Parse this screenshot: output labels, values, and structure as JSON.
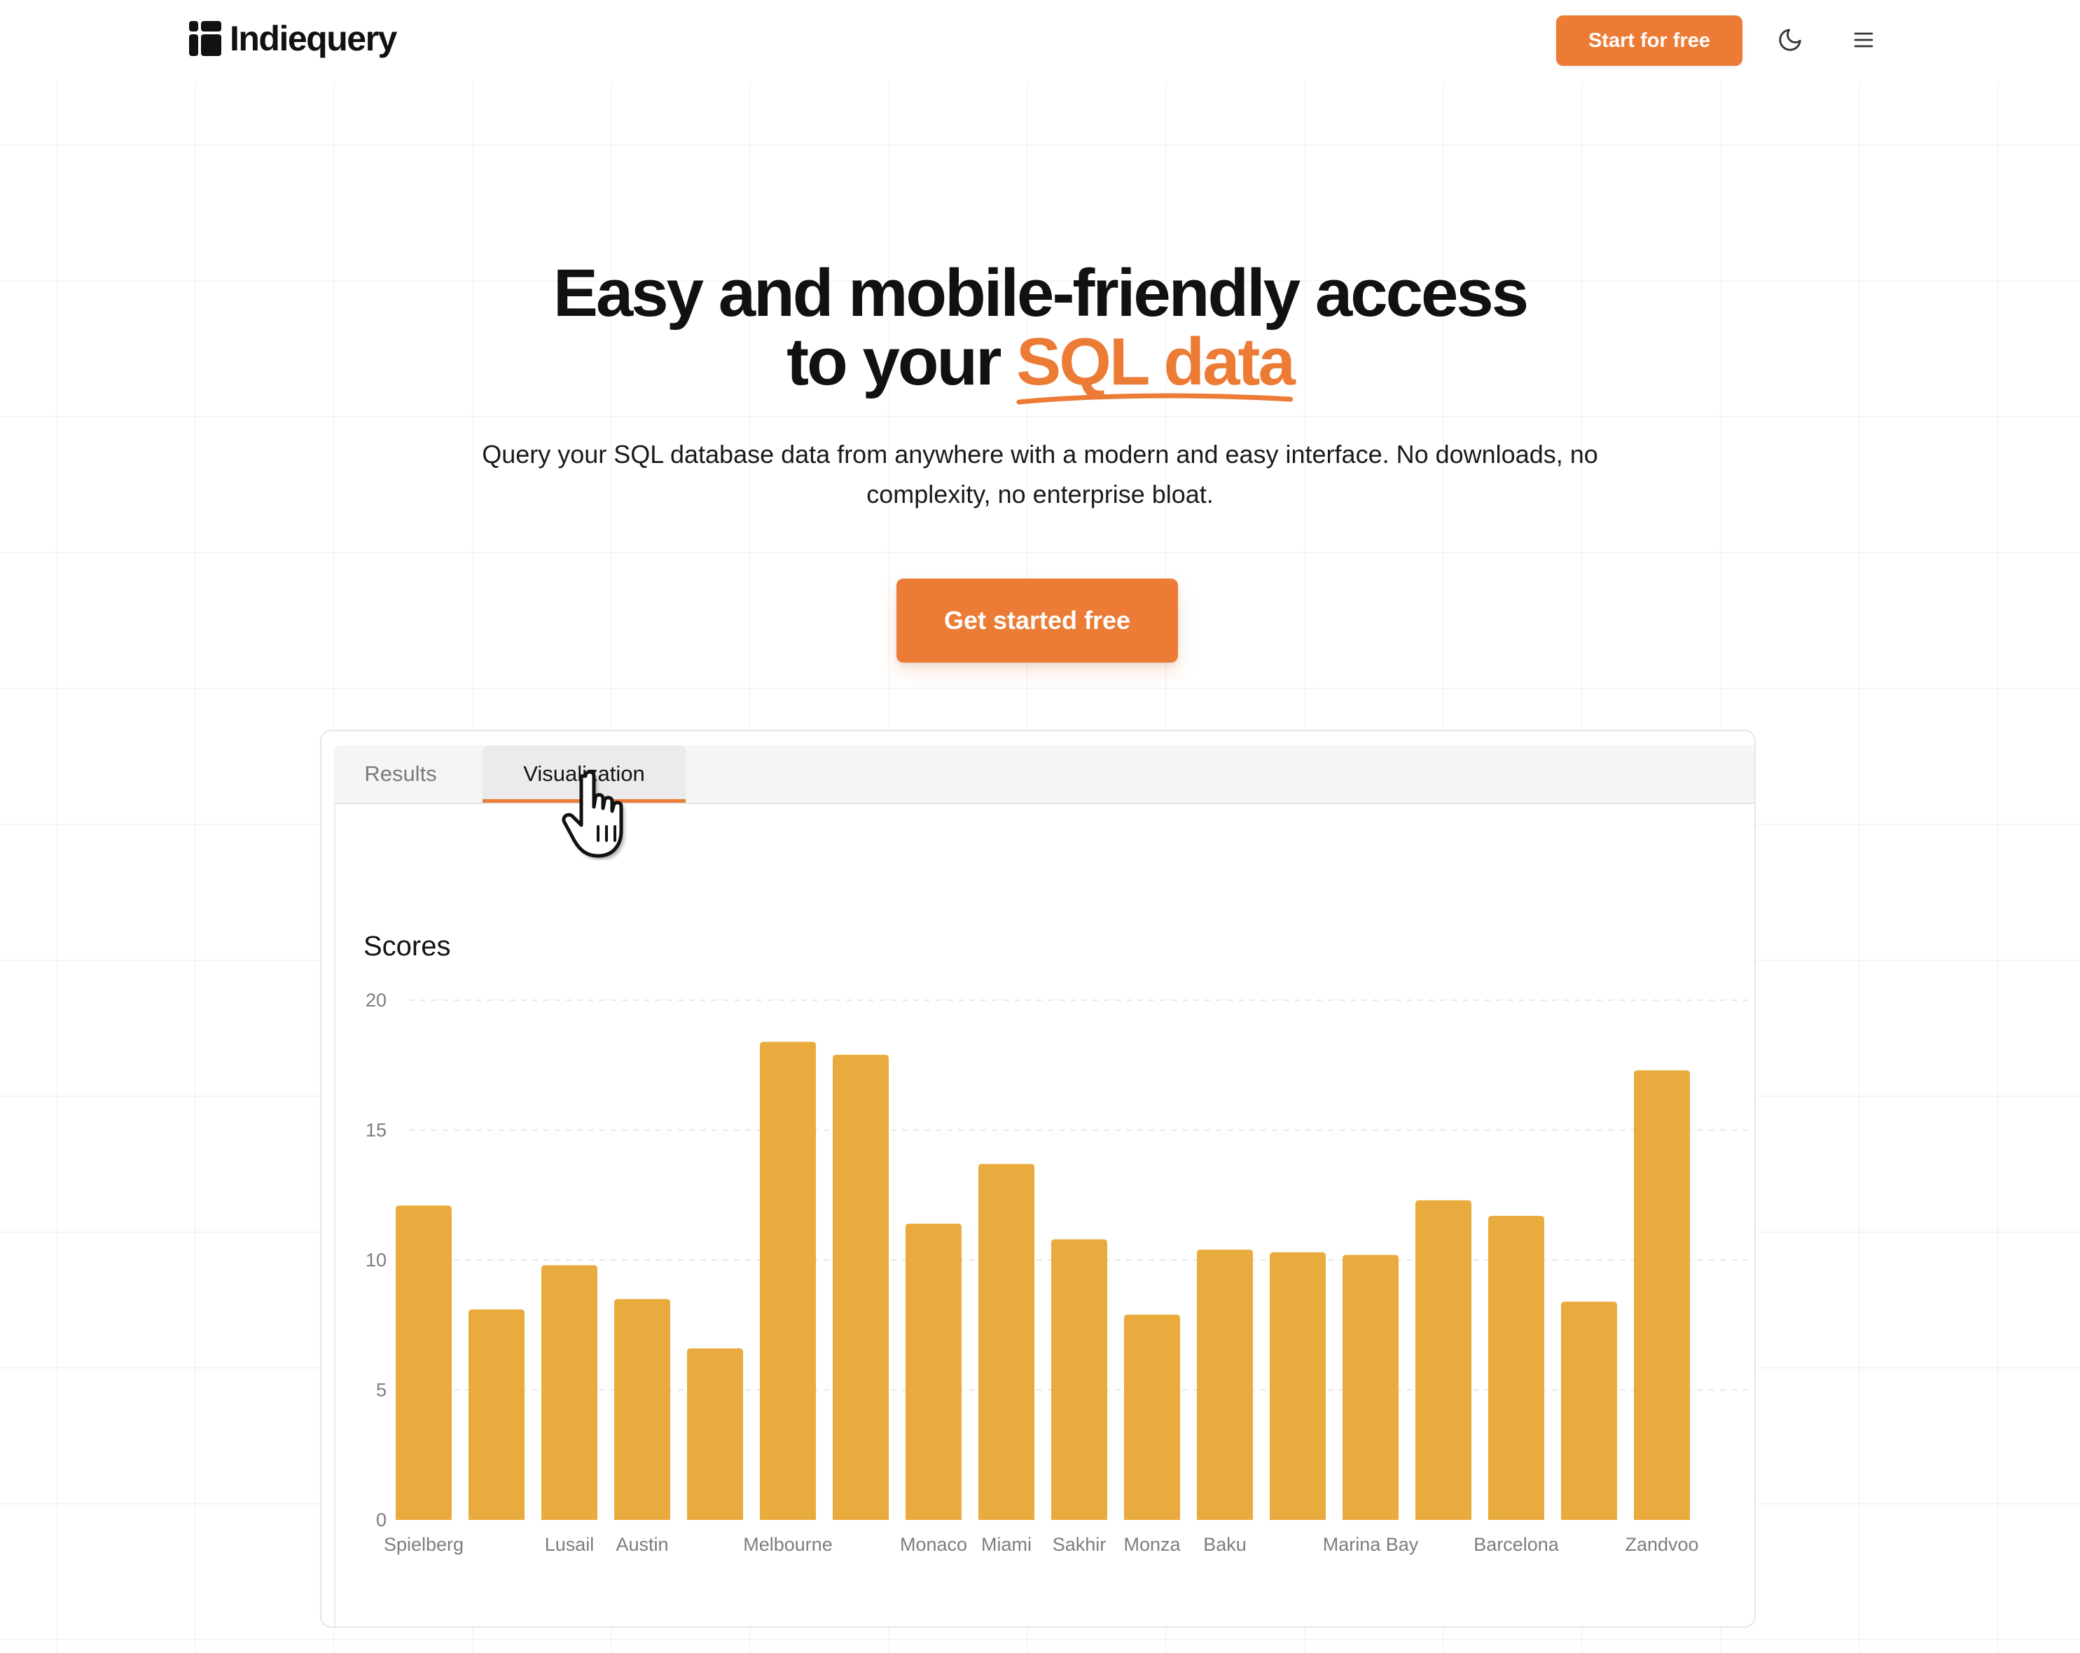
{
  "header": {
    "brand": "Indiequery",
    "start_button": "Start for free",
    "icons": [
      "logo-icon",
      "moon-icon",
      "menu-icon"
    ]
  },
  "hero": {
    "title_line1": "Easy and mobile-friendly access",
    "title_line2_prefix": "to your ",
    "title_line2_accent": "SQL data",
    "subtitle": "Query your SQL database data from anywhere with a modern and easy interface. No downloads, no complexity, no enterprise bloat.",
    "cta_button": "Get started free"
  },
  "panel": {
    "tabs": [
      {
        "label": "Results",
        "active": false
      },
      {
        "label": "Visualization",
        "active": true
      }
    ]
  },
  "colors": {
    "accent": "#ec7b35",
    "bar": "#e9ab3d"
  },
  "chart_data": {
    "type": "bar",
    "title": "Scores",
    "ylim": [
      0,
      20
    ],
    "yticks": [
      0,
      5,
      10,
      15,
      20
    ],
    "grid": true,
    "categories": [
      "Spielberg",
      "",
      "Lusail",
      "Austin",
      "",
      "Melbourne",
      "",
      "Monaco",
      "Miami",
      "Sakhir",
      "Monza",
      "Baku",
      "",
      "Marina Bay",
      "",
      "Barcelona",
      "",
      "Zandvoo"
    ],
    "series": [
      {
        "values": [
          12.1,
          8.1,
          9.8,
          8.5,
          6.6,
          18.4,
          17.9,
          11.4,
          13.7,
          10.8,
          7.9,
          10.4,
          10.3,
          10.2,
          12.3,
          11.7,
          8.4,
          17.3
        ]
      }
    ]
  }
}
